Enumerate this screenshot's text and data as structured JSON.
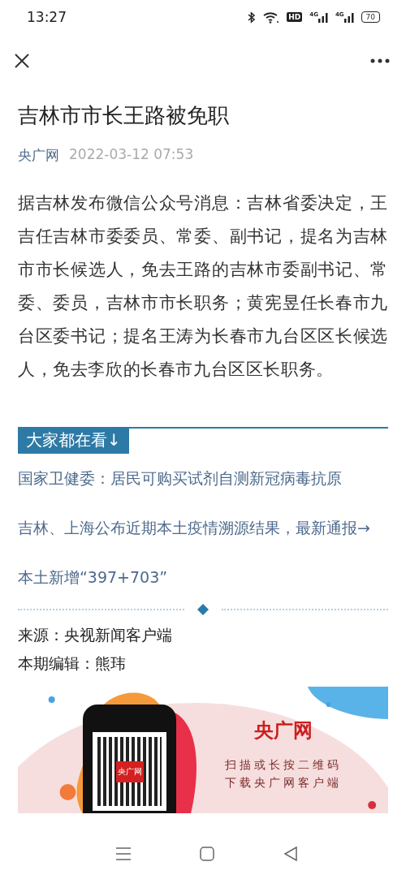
{
  "status_bar": {
    "time": "13:27",
    "hd": "HD",
    "network_1": "4G",
    "network_2": "4G",
    "battery": "70"
  },
  "article": {
    "title": "吉林市市长王路被免职",
    "source": "央广网",
    "date": "2022-03-12 07:53",
    "body": "据吉林发布微信公众号消息：吉林省委决定，王吉任吉林市委委员、常委、副书记，提名为吉林市市长候选人，免去王路的吉林市委副书记、常委、委员，吉林市市长职务；黄宪昱任长春市九台区委书记；提名王涛为长春市九台区区长候选人，免去李欣的长春市九台区区长职务。"
  },
  "related": {
    "heading": "大家都在看↓",
    "links": [
      {
        "text": "国家卫健委：居民可购买试剂自测新冠病毒抗原"
      },
      {
        "text": "吉林、上海公布近期本土疫情溯源结果，最新通报→"
      },
      {
        "text": "本土新增“397+703”"
      }
    ]
  },
  "credits": [
    {
      "text": "来源：央视新闻客户端"
    },
    {
      "text": "本期编辑：熊玮"
    }
  ],
  "banner": {
    "logo": "央广网",
    "lines": [
      "扫描或长按二维码",
      "下载央广网客户端"
    ],
    "qr_badge": "央广网"
  }
}
